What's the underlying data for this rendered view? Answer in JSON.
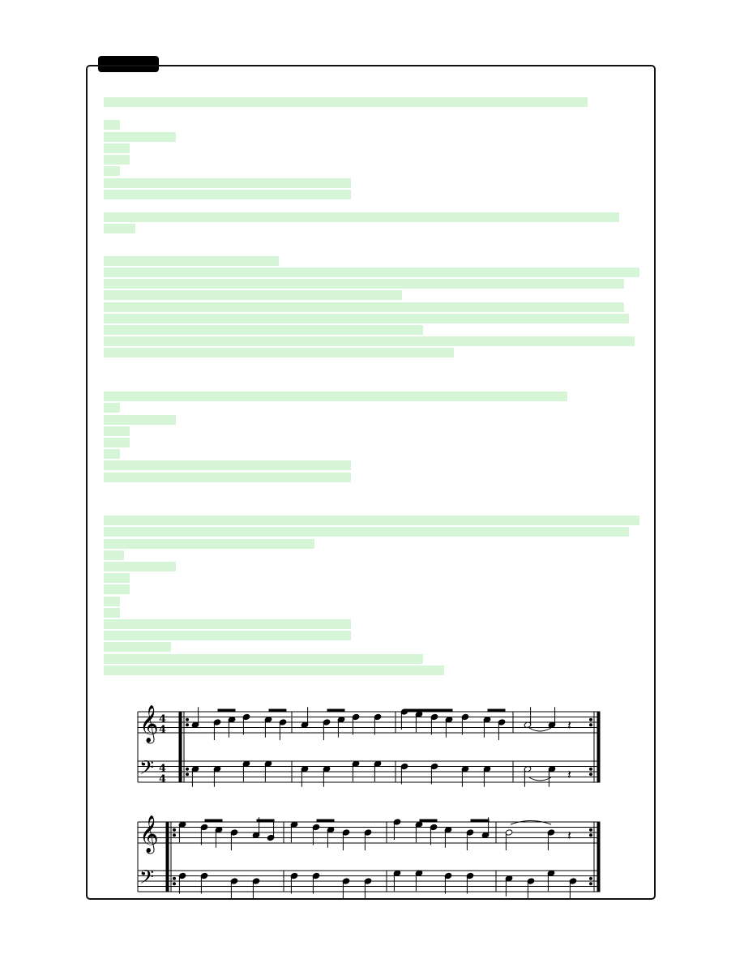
{
  "document": {
    "tab_label": "",
    "redacted_text_blocks": 6,
    "score": {
      "systems": 2,
      "clefs": [
        "treble",
        "bass"
      ],
      "time_signature": "4/4",
      "repeat": true
    }
  }
}
